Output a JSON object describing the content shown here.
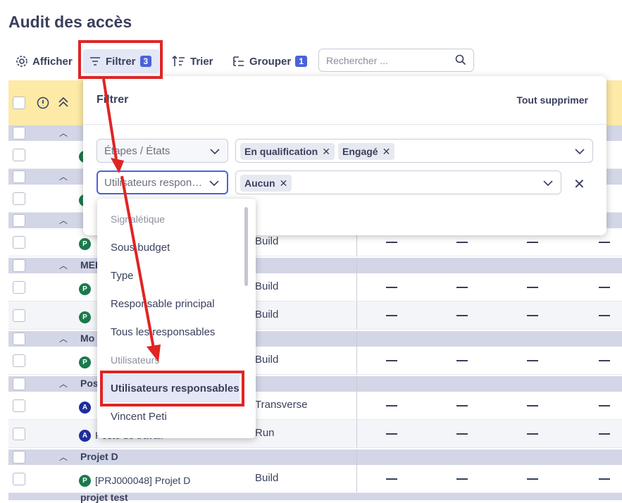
{
  "page": {
    "title": "Audit des accès"
  },
  "toolbar": {
    "show_label": "Afficher",
    "filter_label": "Filtrer",
    "filter_count": "3",
    "sort_label": "Trier",
    "group_label": "Grouper",
    "group_count": "1",
    "search_placeholder": "Rechercher ..."
  },
  "table": {
    "groups": [
      {
        "label": ""
      },
      {
        "label": ""
      },
      {
        "label": ""
      },
      {
        "label": "MEI"
      },
      {
        "label": "Mo"
      },
      {
        "label": "Pos"
      },
      {
        "label": "Projet D"
      },
      {
        "label": "projet test"
      }
    ],
    "items": [
      {
        "avatar": "P",
        "name": "",
        "type": "Build"
      },
      {
        "avatar": "P",
        "name": "",
        "type": "Build"
      },
      {
        "avatar": "P",
        "name": "",
        "type": "Build"
      },
      {
        "avatar": "P",
        "name": "",
        "type": "Build"
      },
      {
        "avatar": "P",
        "name": "",
        "type": "Build"
      },
      {
        "avatar": "A",
        "name": "",
        "type": "Transverse"
      },
      {
        "avatar": "A",
        "name": "Poste de travail",
        "type": "Run"
      },
      {
        "avatar": "P",
        "name": "[PRJ000048] Projet D",
        "type": "Build"
      }
    ],
    "empty_value": "—"
  },
  "filter_panel": {
    "title": "Filtrer",
    "clear_all": "Tout supprimer",
    "rows": [
      {
        "field": "Étapes / États",
        "values": [
          "En qualification",
          "Engagé"
        ]
      },
      {
        "field": "Utilisateurs respon…",
        "values": [
          "Aucun"
        ]
      }
    ]
  },
  "dropdown": {
    "headers": [
      "Signalétique",
      "Utilisateurs"
    ],
    "items": [
      "Sous budget",
      "Type",
      "Responsable principal",
      "Tous les responsables",
      "Utilisateurs responsables",
      "Vincent Peti"
    ],
    "selected": "Utilisateurs responsables"
  },
  "colors": {
    "accent": "#4a63d8",
    "annotation": "#e02424",
    "group_row": "#d3d6e6",
    "header": "#fdeaa6"
  }
}
